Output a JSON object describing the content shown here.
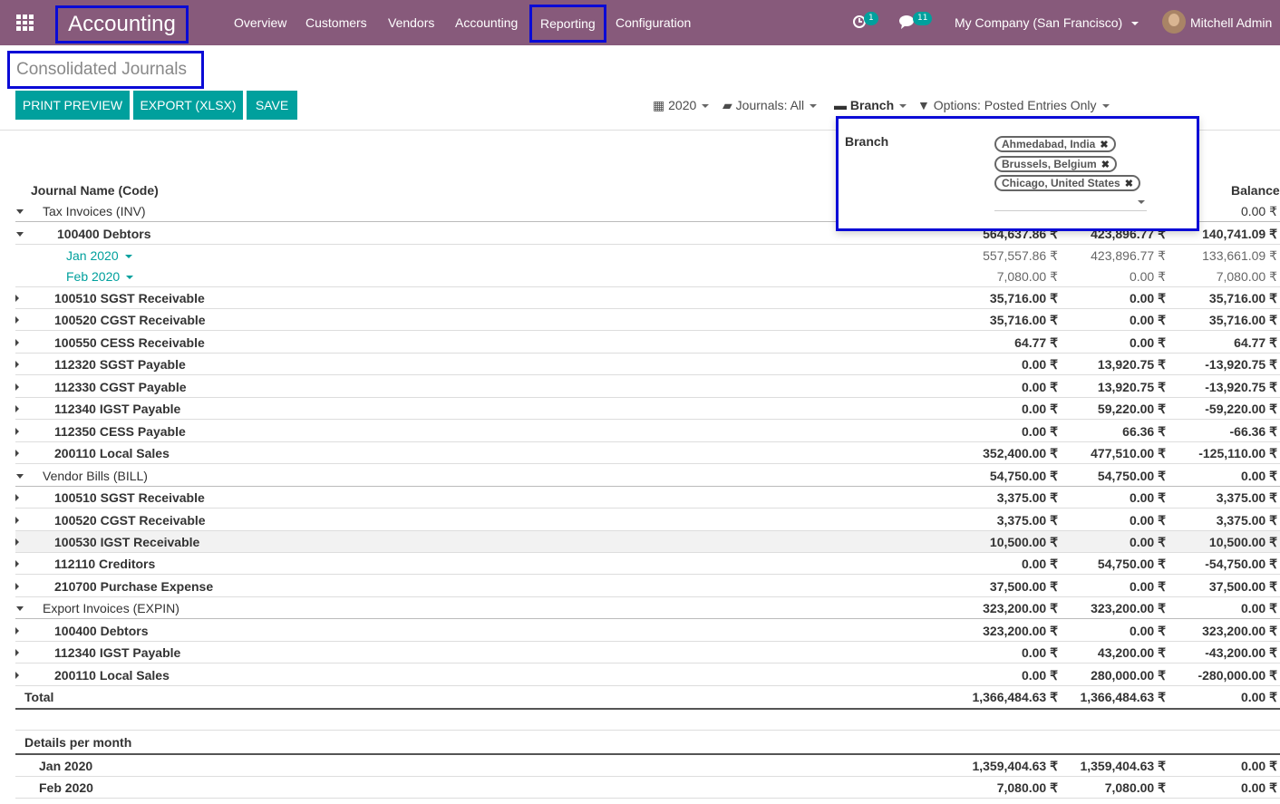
{
  "navbar": {
    "app_name": "Accounting",
    "menus": [
      "Overview",
      "Customers",
      "Vendors",
      "Accounting",
      "Reporting",
      "Configuration"
    ],
    "activity_count": "1",
    "messages_count": "11",
    "company": "My Company (San Francisco)",
    "user": "Mitchell Admin"
  },
  "page": {
    "title": "Consolidated Journals",
    "buttons": {
      "print": "PRINT PREVIEW",
      "export": "EXPORT (XLSX)",
      "save": "SAVE"
    },
    "filters": {
      "date": "2020",
      "journals": "Journals: All",
      "branch": "Branch",
      "options": "Options: Posted Entries Only"
    }
  },
  "branch_dropdown": {
    "label": "Branch",
    "tags": [
      "Ahmedabad, India",
      "Brussels, Belgium",
      "Chicago, United States"
    ]
  },
  "table": {
    "headers": {
      "name": "Journal Name (Code)",
      "balance": "Balance"
    },
    "rows": [
      {
        "label": "Tax Invoices (INV)",
        "c1": "",
        "c2": "",
        "c3": "0.00 ₹"
      },
      {
        "label": "100400 Debtors",
        "c1": "564,637.86 ₹",
        "c2": "423,896.77 ₹",
        "c3": "140,741.09 ₹"
      },
      {
        "label": "Jan 2020",
        "c1": "557,557.86 ₹",
        "c2": "423,896.77 ₹",
        "c3": "133,661.09 ₹"
      },
      {
        "label": "Feb 2020",
        "c1": "7,080.00 ₹",
        "c2": "0.00 ₹",
        "c3": "7,080.00 ₹"
      },
      {
        "label": "100510 SGST Receivable",
        "c1": "35,716.00 ₹",
        "c2": "0.00 ₹",
        "c3": "35,716.00 ₹"
      },
      {
        "label": "100520 CGST Receivable",
        "c1": "35,716.00 ₹",
        "c2": "0.00 ₹",
        "c3": "35,716.00 ₹"
      },
      {
        "label": "100550 CESS Receivable",
        "c1": "64.77 ₹",
        "c2": "0.00 ₹",
        "c3": "64.77 ₹"
      },
      {
        "label": "112320 SGST Payable",
        "c1": "0.00 ₹",
        "c2": "13,920.75 ₹",
        "c3": "-13,920.75 ₹"
      },
      {
        "label": "112330 CGST Payable",
        "c1": "0.00 ₹",
        "c2": "13,920.75 ₹",
        "c3": "-13,920.75 ₹"
      },
      {
        "label": "112340 IGST Payable",
        "c1": "0.00 ₹",
        "c2": "59,220.00 ₹",
        "c3": "-59,220.00 ₹"
      },
      {
        "label": "112350 CESS Payable",
        "c1": "0.00 ₹",
        "c2": "66.36 ₹",
        "c3": "-66.36 ₹"
      },
      {
        "label": "200110 Local Sales",
        "c1": "352,400.00 ₹",
        "c2": "477,510.00 ₹",
        "c3": "-125,110.00 ₹"
      },
      {
        "label": "Vendor Bills (BILL)",
        "c1": "54,750.00 ₹",
        "c2": "54,750.00 ₹",
        "c3": "0.00 ₹"
      },
      {
        "label": "100510 SGST Receivable",
        "c1": "3,375.00 ₹",
        "c2": "0.00 ₹",
        "c3": "3,375.00 ₹"
      },
      {
        "label": "100520 CGST Receivable",
        "c1": "3,375.00 ₹",
        "c2": "0.00 ₹",
        "c3": "3,375.00 ₹"
      },
      {
        "label": "100530 IGST Receivable",
        "c1": "10,500.00 ₹",
        "c2": "0.00 ₹",
        "c3": "10,500.00 ₹"
      },
      {
        "label": "112110 Creditors",
        "c1": "0.00 ₹",
        "c2": "54,750.00 ₹",
        "c3": "-54,750.00 ₹"
      },
      {
        "label": "210700 Purchase Expense",
        "c1": "37,500.00 ₹",
        "c2": "0.00 ₹",
        "c3": "37,500.00 ₹"
      },
      {
        "label": "Export Invoices (EXPIN)",
        "c1": "323,200.00 ₹",
        "c2": "323,200.00 ₹",
        "c3": "0.00 ₹"
      },
      {
        "label": "100400 Debtors",
        "c1": "323,200.00 ₹",
        "c2": "0.00 ₹",
        "c3": "323,200.00 ₹"
      },
      {
        "label": "112340 IGST Payable",
        "c1": "0.00 ₹",
        "c2": "43,200.00 ₹",
        "c3": "-43,200.00 ₹"
      },
      {
        "label": "200110 Local Sales",
        "c1": "0.00 ₹",
        "c2": "280,000.00 ₹",
        "c3": "-280,000.00 ₹"
      },
      {
        "label": "Total",
        "c1": "1,366,484.63 ₹",
        "c2": "1,366,484.63 ₹",
        "c3": "0.00 ₹"
      }
    ],
    "details_title": "Details per month",
    "details": [
      {
        "label": "Jan 2020",
        "c1": "1,359,404.63 ₹",
        "c2": "1,359,404.63 ₹",
        "c3": "0.00 ₹"
      },
      {
        "label": "Feb 2020",
        "c1": "7,080.00 ₹",
        "c2": "7,080.00 ₹",
        "c3": "0.00 ₹"
      }
    ]
  },
  "colors": {
    "navbar": "#875a7b",
    "primary": "#00a09d",
    "highlight_border": "#0a0ad6"
  }
}
